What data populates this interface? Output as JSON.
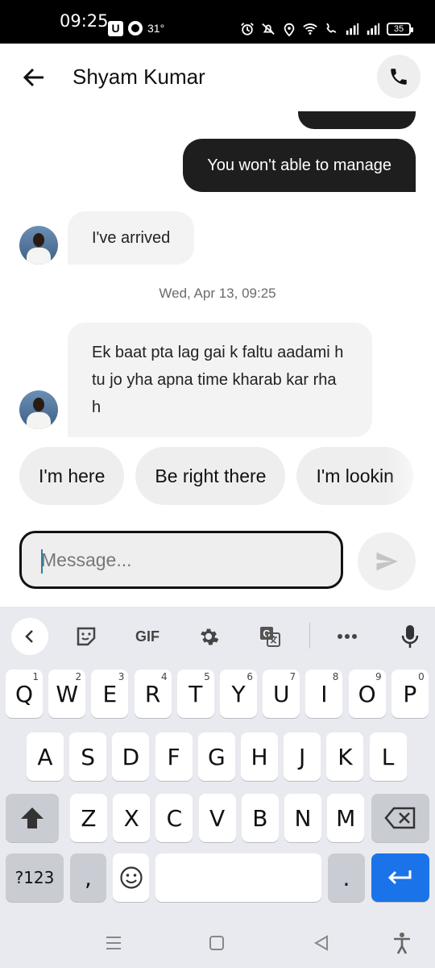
{
  "status_bar": {
    "time": "09:25",
    "temperature": "31°",
    "battery": "35"
  },
  "header": {
    "contact_name": "Shyam Kumar",
    "back_icon": "arrow-left-icon",
    "call_icon": "phone-icon"
  },
  "messages": {
    "outgoing_last": "You won't able to manage",
    "incoming_1": "I've arrived",
    "timestamp": "Wed, Apr 13, 09:25",
    "incoming_2": "Ek baat pta lag gai k faltu aadami h tu jo yha apna time kharab kar rha h"
  },
  "quick_replies": [
    "I'm here",
    "Be right there",
    "I'm lookin"
  ],
  "composer": {
    "placeholder": "Message...",
    "send_icon": "send-icon"
  },
  "keyboard": {
    "toolbar_gif": "GIF",
    "row1": [
      {
        "label": "Q",
        "hint": "1"
      },
      {
        "label": "W",
        "hint": "2"
      },
      {
        "label": "E",
        "hint": "3"
      },
      {
        "label": "R",
        "hint": "4"
      },
      {
        "label": "T",
        "hint": "5"
      },
      {
        "label": "Y",
        "hint": "6"
      },
      {
        "label": "U",
        "hint": "7"
      },
      {
        "label": "I",
        "hint": "8"
      },
      {
        "label": "O",
        "hint": "9"
      },
      {
        "label": "P",
        "hint": "0"
      }
    ],
    "row2": [
      "A",
      "S",
      "D",
      "F",
      "G",
      "H",
      "J",
      "K",
      "L"
    ],
    "row3": [
      "Z",
      "X",
      "C",
      "V",
      "B",
      "N",
      "M"
    ],
    "symbols_label": "?123",
    "comma_label": ",",
    "period_label": ".",
    "accent_color": "#1a73e8"
  }
}
